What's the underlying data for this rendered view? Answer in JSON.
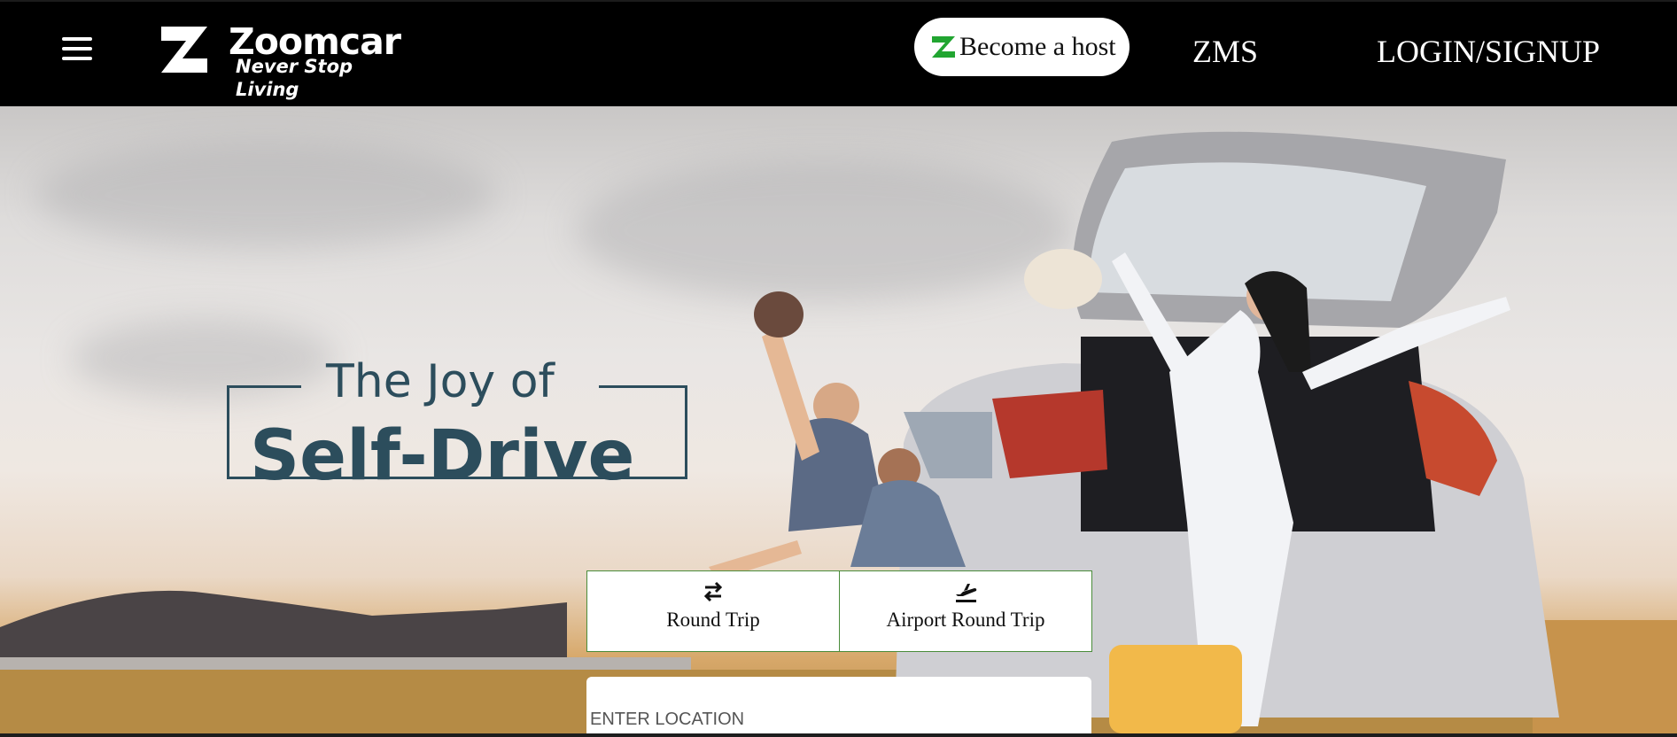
{
  "header": {
    "menu_icon": "hamburger-menu-icon",
    "logo": {
      "wordmark": "Zoomcar",
      "tagline": "Never Stop Living"
    },
    "host_button": {
      "icon": "zoomcar-z-icon",
      "label": "Become a host",
      "icon_color": "#21a531"
    },
    "nav": {
      "zms": "ZMS",
      "login": "LOGIN/SIGNUP"
    }
  },
  "hero": {
    "headline_top": "The Joy of",
    "headline_main": "Self-Drive",
    "headline_color": "#2c4d5c"
  },
  "trip_tabs": [
    {
      "label": "Round Trip",
      "icon": "swap-arrows-icon"
    },
    {
      "label": "Airport Round Trip",
      "icon": "airplane-takeoff-icon"
    }
  ],
  "search": {
    "location_placeholder": "ENTER LOCATION"
  },
  "colors": {
    "header_bg": "#000000",
    "tab_border": "#4a8c3a",
    "brand_green": "#21a531"
  }
}
